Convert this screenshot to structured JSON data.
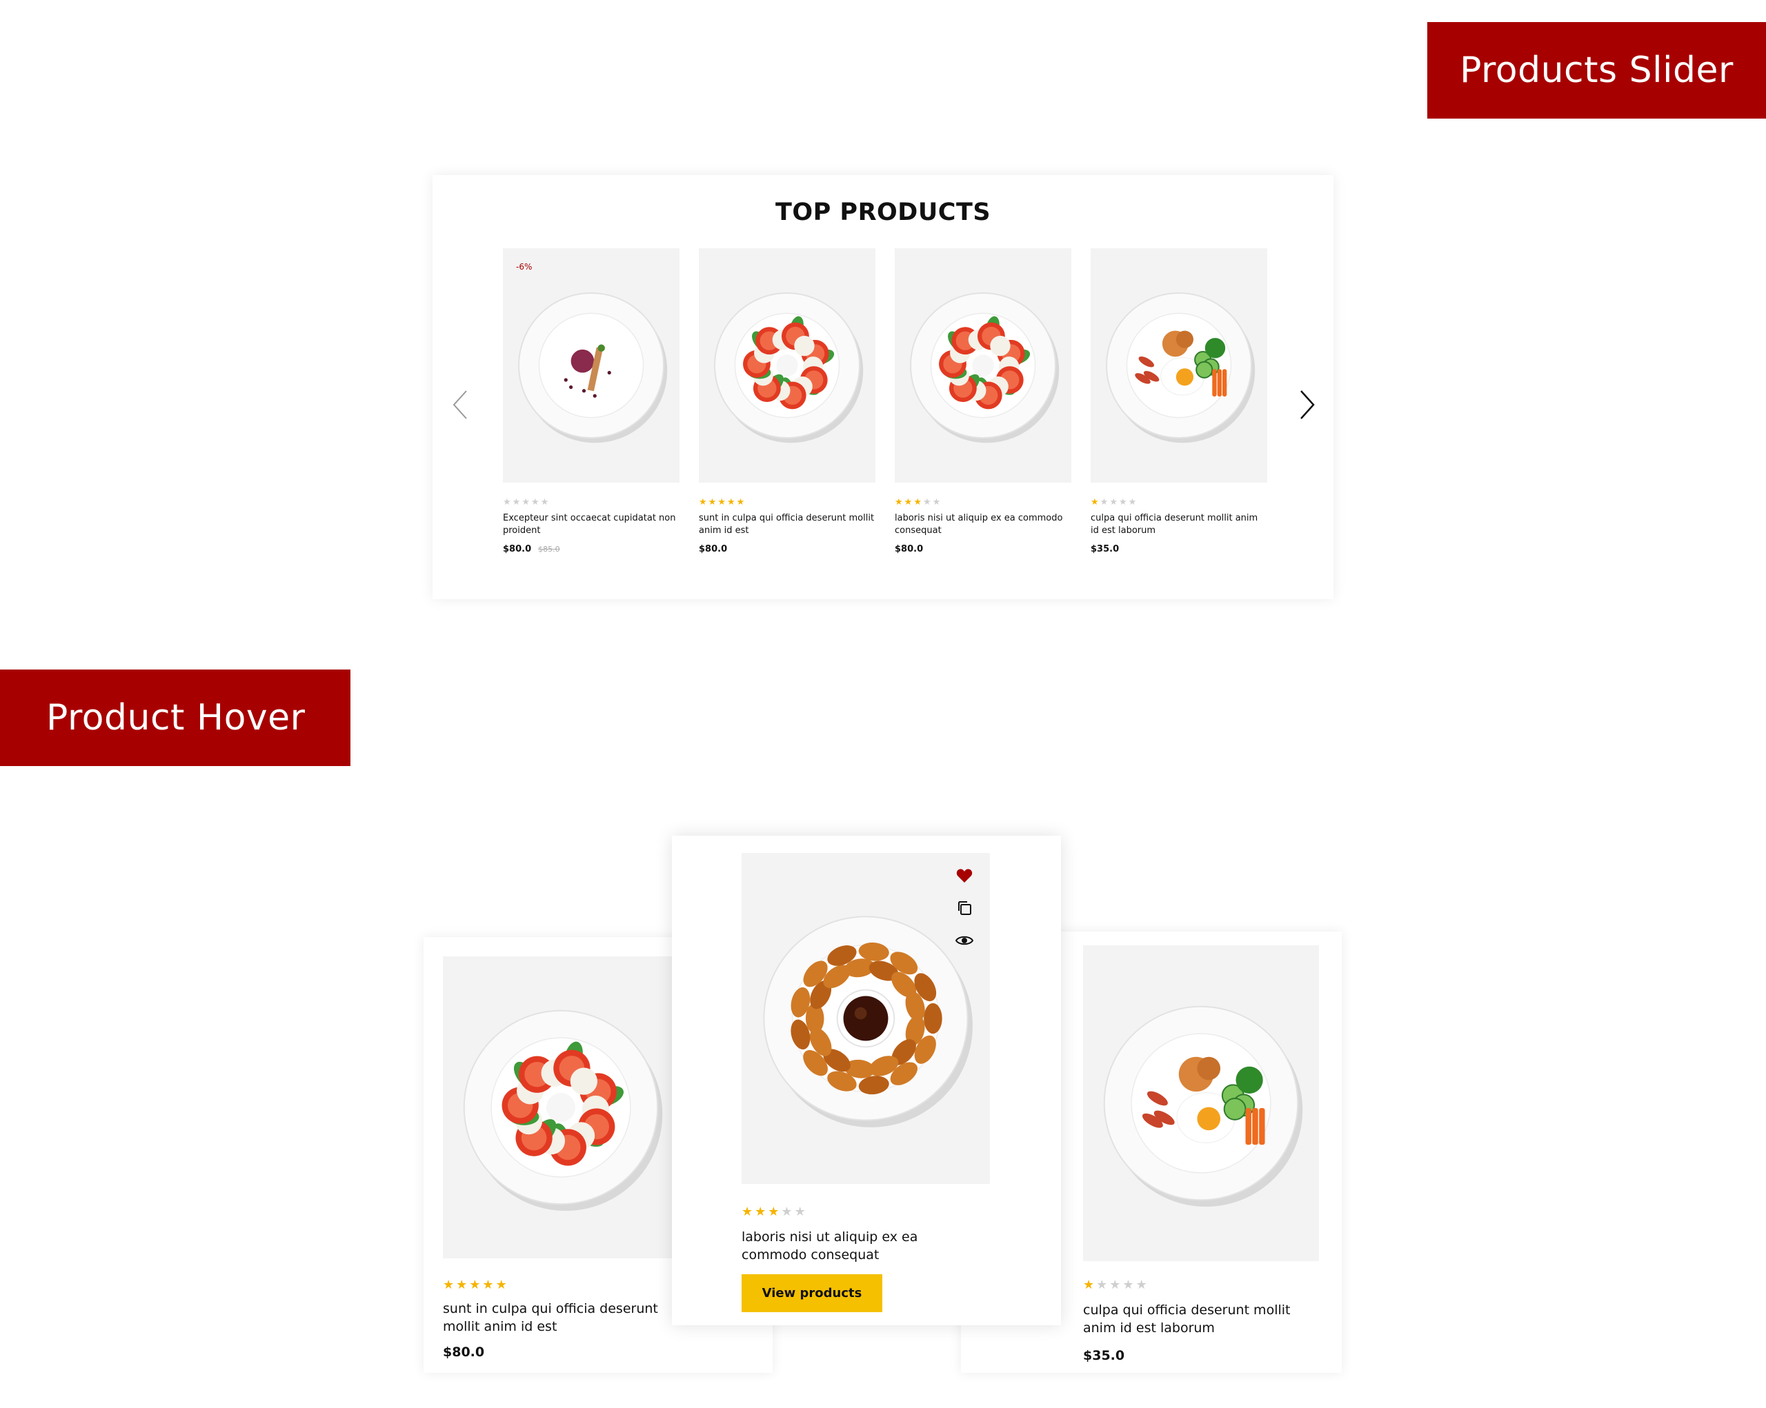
{
  "banners": {
    "slider": "Products Slider",
    "hover": "Product Hover"
  },
  "slider": {
    "title": "TOP PRODUCTS",
    "products": [
      {
        "badge": "-6%",
        "rating": 0,
        "name": "Excepteur sint occaecat cupidatat non proident",
        "price": "$80.0",
        "old_price": "$85.0",
        "dish": "dessert-plate"
      },
      {
        "badge": "",
        "rating": 5,
        "name": "sunt in culpa qui officia deserunt mollit anim id est",
        "price": "$80.0",
        "old_price": "",
        "dish": "caprese-plate"
      },
      {
        "badge": "",
        "rating": 3,
        "name": "laboris nisi ut aliquip ex ea commodo consequat",
        "price": "$80.0",
        "old_price": "",
        "dish": "caprese-plate"
      },
      {
        "badge": "",
        "rating": 1,
        "name": "culpa qui officia deserunt mollit anim id est laborum",
        "price": "$35.0",
        "old_price": "",
        "dish": "breakfast-plate"
      }
    ]
  },
  "hover": {
    "left": {
      "rating": 5,
      "name_line1": "sunt in culpa qui officia deserunt",
      "name_line2": "mollit anim id est",
      "price": "$80.0",
      "dish": "caprese-plate"
    },
    "center": {
      "rating": 3,
      "name_line1": "laboris nisi ut aliquip ex ea",
      "name_line2": "commodo consequat",
      "button": "View products",
      "dish": "fried-chicken-plate",
      "icons": [
        "heart-icon",
        "compare-icon",
        "eye-icon"
      ]
    },
    "right": {
      "rating": 1,
      "name_line1": "culpa qui officia deserunt mollit",
      "name_line2": "anim id est laborum",
      "price": "$35.0",
      "dish": "breakfast-plate"
    }
  },
  "colors": {
    "brand_red": "#a70000",
    "star": "#f5b400",
    "button": "#f5c000",
    "image_bg": "#f3f3f3"
  }
}
